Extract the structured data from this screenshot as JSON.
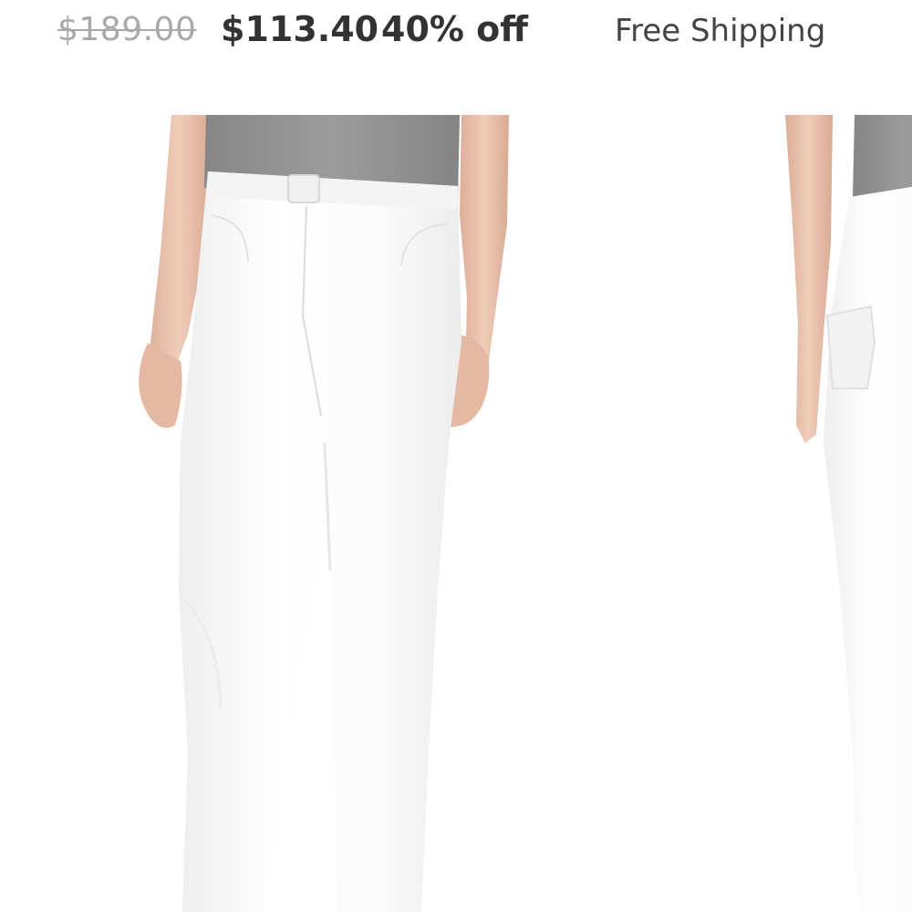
{
  "pricing": {
    "original_price": "$189.00",
    "sale_price": "$113.40",
    "discount": "40% off",
    "shipping": "Free Shipping"
  },
  "gallery": {
    "images": [
      "jeans-front-view",
      "jeans-back-view"
    ]
  },
  "colors": {
    "text_dark": "#333333",
    "text_muted": "#a9a9a9",
    "shirt_gray": "#8e8f8e",
    "skin": "#e9c2ad",
    "jeans_white": "#fbfbfb"
  }
}
